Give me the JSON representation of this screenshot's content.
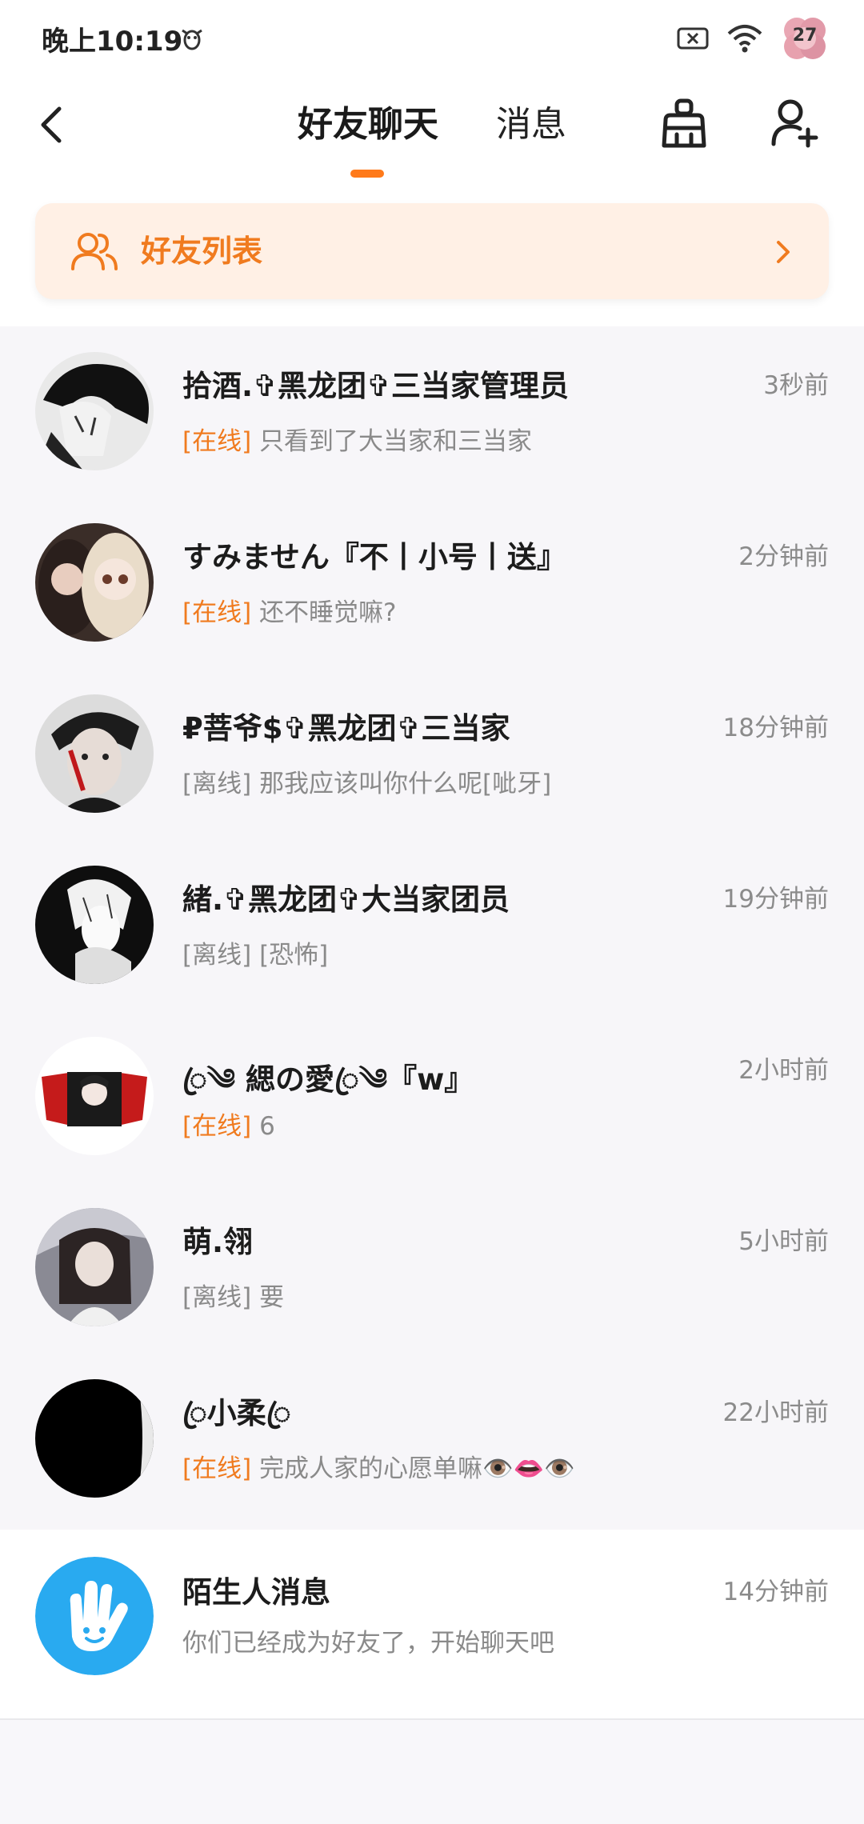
{
  "status_bar": {
    "time": "晚上10:19",
    "notification_badge": "27"
  },
  "header": {
    "tabs": [
      {
        "label": "好友聊天",
        "active": true
      },
      {
        "label": "消息",
        "active": false
      }
    ],
    "accent_color": "#ff7a1a"
  },
  "friend_list_banner": {
    "label": "好友列表"
  },
  "conversations": [
    {
      "name": "拾酒.✞黑龙团✞三当家管理员",
      "time": "3秒前",
      "status": "[在线]",
      "online": true,
      "message": "只看到了大当家和三当家"
    },
    {
      "name": "すみません『不丨小号丨送』",
      "time": "2分钟前",
      "status": "[在线]",
      "online": true,
      "message": "还不睡觉嘛?"
    },
    {
      "name": "₽菩爷$✞黑龙团✞三当家",
      "time": "18分钟前",
      "status": "[离线]",
      "online": false,
      "message": "那我应该叫你什么呢[呲牙]"
    },
    {
      "name": "緒.✞黑龙团✞大当家团员",
      "time": "19分钟前",
      "status": "[离线]",
      "online": false,
      "message": "[恐怖]"
    },
    {
      "name": "ꦿ༄ 緦の愛ꦿ༄『w』",
      "time": "2小时前",
      "status": "[在线]",
      "online": true,
      "message": "6"
    },
    {
      "name": "萌.翎",
      "time": "5小时前",
      "status": "[离线]",
      "online": false,
      "message": "要"
    },
    {
      "name": "ꦿ小柔ꦿ",
      "time": "22小时前",
      "status": "[在线]",
      "online": true,
      "message": "完成人家的心愿单嘛👁️👄👁️"
    }
  ],
  "stranger_messages": {
    "name": "陌生人消息",
    "time": "14分钟前",
    "message": "你们已经成为好友了，开始聊天吧"
  }
}
